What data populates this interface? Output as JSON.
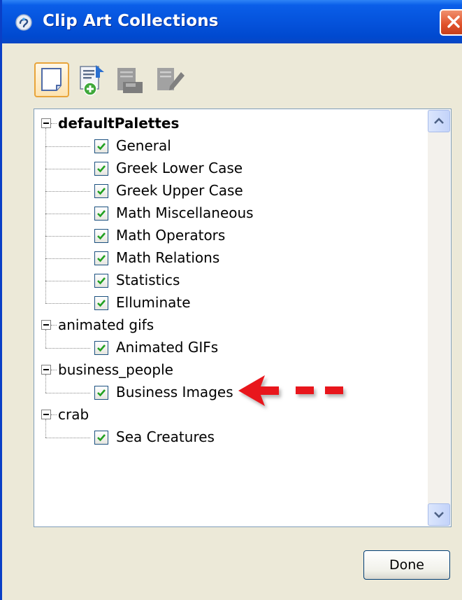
{
  "window": {
    "title": "Clip Art Collections",
    "accent_color": "#0553dc"
  },
  "toolbar": {
    "buttons": [
      {
        "icon": "new-collection-icon"
      },
      {
        "icon": "add-clipart-icon"
      },
      {
        "icon": "save-icon"
      },
      {
        "icon": "edit-icon"
      }
    ]
  },
  "tree": {
    "groups": [
      {
        "label": "defaultPalettes",
        "bold": true,
        "items": [
          {
            "label": "General",
            "checked": true
          },
          {
            "label": "Greek Lower Case",
            "checked": true
          },
          {
            "label": "Greek Upper Case",
            "checked": true
          },
          {
            "label": "Math Miscellaneous",
            "checked": true
          },
          {
            "label": "Math Operators",
            "checked": true
          },
          {
            "label": "Math Relations",
            "checked": true
          },
          {
            "label": "Statistics",
            "checked": true
          },
          {
            "label": " Elluminate",
            "checked": true
          }
        ]
      },
      {
        "label": "animated gifs",
        "bold": false,
        "items": [
          {
            "label": "Animated GIFs",
            "checked": true
          }
        ]
      },
      {
        "label": "business_people",
        "bold": false,
        "items": [
          {
            "label": "Business Images",
            "checked": true
          }
        ]
      },
      {
        "label": "crab",
        "bold": false,
        "items": [
          {
            "label": "Sea Creatures",
            "checked": true
          }
        ]
      }
    ]
  },
  "annotation": {
    "icon": "red-dashed-arrow-icon",
    "color": "#e8141b"
  },
  "footer": {
    "done_label": "Done"
  }
}
